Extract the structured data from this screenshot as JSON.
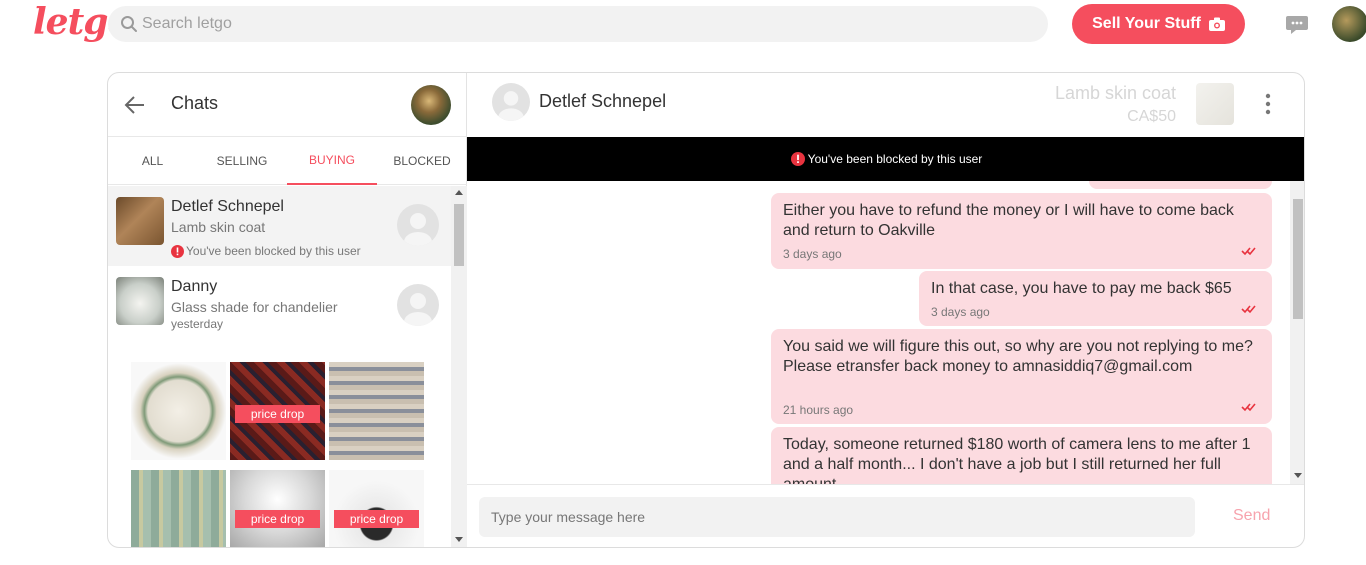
{
  "brand": {
    "logo": "letgo",
    "accent": "#f54e5e"
  },
  "search": {
    "placeholder": "Search letgo"
  },
  "header": {
    "sell_label": "Sell Your Stuff"
  },
  "chats_panel": {
    "title": "Chats",
    "tabs": [
      {
        "label": "ALL"
      },
      {
        "label": "SELLING"
      },
      {
        "label": "BUYING"
      },
      {
        "label": "BLOCKED"
      }
    ],
    "active_tab": "BUYING",
    "conversations": [
      {
        "name": "Detlef Schnepel",
        "item": "Lamb skin coat",
        "status": "You've been blocked by this user"
      },
      {
        "name": "Danny",
        "item": "Glass shade for chandelier",
        "status": "yesterday"
      }
    ],
    "ad": {
      "tags": [
        "price drop",
        "price drop",
        "price drop"
      ]
    }
  },
  "conversation": {
    "contact_name": "Detlef Schnepel",
    "product_title": "Lamb skin coat",
    "product_price": "CA$50",
    "blocked_notice": "You've been blocked by this user",
    "messages": [
      {
        "text": "Either you have to refund the money or I will have to come back and return to Oakville",
        "time": "3 days ago"
      },
      {
        "text": "In that case, you have to pay me back $65",
        "time": "3 days ago"
      },
      {
        "text": "You said we will figure this out, so why are you not replying to me? Please etransfer back money to amnasiddiq7@gmail.com",
        "time": "21 hours ago"
      },
      {
        "text": "Today, someone returned $180 worth of camera lens to me after 1 and a half month... I don't have a job but I still returned her full amount",
        "time": ""
      }
    ],
    "composer_placeholder": "Type your message here",
    "send_label": "Send"
  }
}
